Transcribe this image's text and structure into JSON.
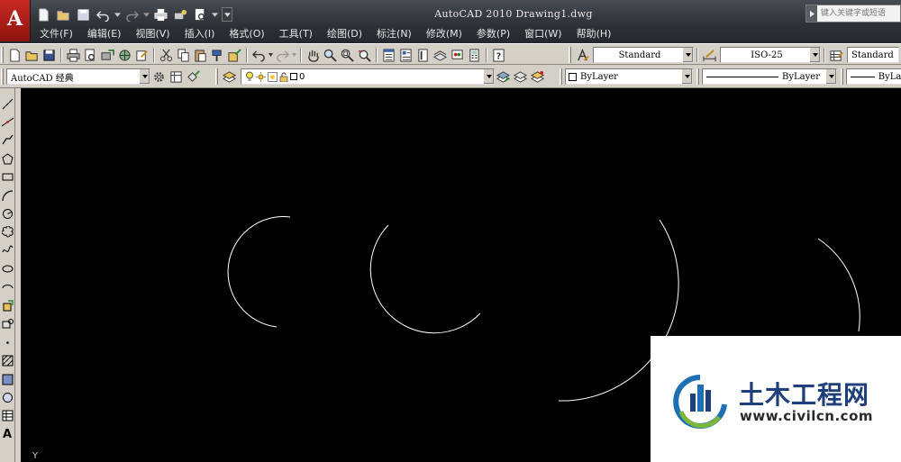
{
  "app": {
    "logo_letter": "A",
    "window_title": "AutoCAD 2010   Drawing1.dwg",
    "search_placeholder": "键入关键字或短语"
  },
  "menu": [
    "文件(F)",
    "编辑(E)",
    "视图(V)",
    "插入(I)",
    "格式(O)",
    "工具(T)",
    "绘图(D)",
    "标注(N)",
    "修改(M)",
    "参数(P)",
    "窗口(W)",
    "帮助(H)"
  ],
  "toolbar": {
    "text_style": "Standard",
    "dim_style": "ISO-25",
    "table_style": "Standard",
    "workspace": "AutoCAD 经典",
    "layer": "0",
    "color": "ByLayer",
    "linetype": "ByLayer",
    "lineweight": "ByLay"
  },
  "drawing": {
    "ucs_axis_label": "Y",
    "background": "#000000",
    "stroke": "#ffffff"
  },
  "watermark": {
    "title": "土木工程网",
    "url": "www.civilcn.com"
  },
  "colors": {
    "title_bar": "#2f3237",
    "toolbar": "#d4d0c8",
    "logo_red": "#b3201a",
    "watermark_blue": "#1f3f7a"
  }
}
